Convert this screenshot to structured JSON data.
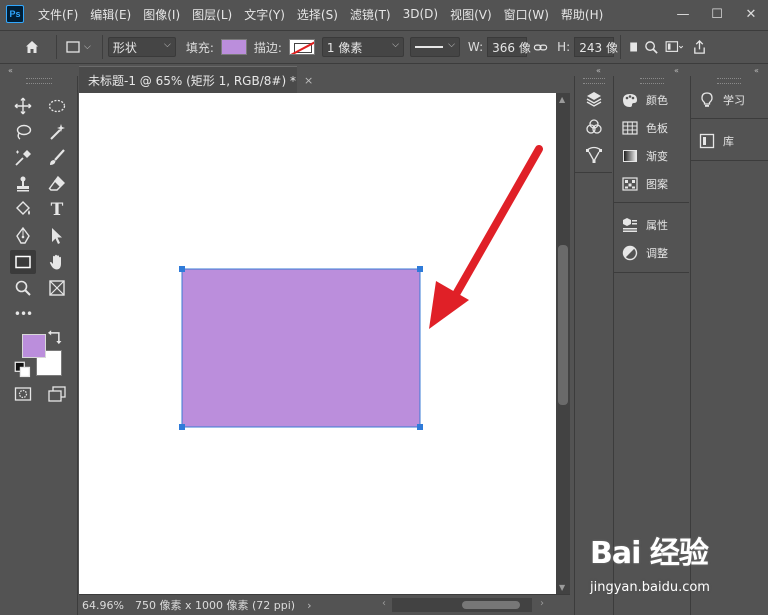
{
  "app": {
    "logo_text": "Ps",
    "menus": [
      "文件(F)",
      "编辑(E)",
      "图像(I)",
      "图层(L)",
      "文字(Y)",
      "选择(S)",
      "滤镜(T)",
      "3D(D)",
      "视图(V)",
      "窗口(W)",
      "帮助(H)"
    ],
    "window_buttons": {
      "minimize": "—",
      "restore": "☐",
      "close": "✕"
    }
  },
  "options_bar": {
    "home_icon": "home-icon",
    "tool_mode": "形状",
    "fill_label": "填充:",
    "fill_color": "#BB8EDC",
    "stroke_label": "描边:",
    "stroke_width": "1 像素",
    "width_label": "W:",
    "width_value": "366 像",
    "height_label": "H:",
    "height_value": "243 像"
  },
  "document": {
    "tab_title": "未标题-1 @ 65% (矩形 1, RGB/8#) *",
    "close_glyph": "×",
    "zoom": "64.96%",
    "info": "750 像素 x 1000 像素 (72 ppi)",
    "status_arrow": "›",
    "rect_color": "#BB8EDC",
    "rect_stroke": "#3A7BD5",
    "arrow_color": "#E02027"
  },
  "toolbar": {
    "foreground_color": "#BB8EDC",
    "background_color": "#FFFFFF",
    "more_glyph": "•••"
  },
  "panels": {
    "group1": [
      {
        "icon": "color-icon",
        "label": "颜色"
      },
      {
        "icon": "swatches-icon",
        "label": "色板"
      },
      {
        "icon": "gradient-icon",
        "label": "渐变"
      },
      {
        "icon": "patterns-icon",
        "label": "图案"
      }
    ],
    "group2": [
      {
        "icon": "properties-icon",
        "label": "属性"
      },
      {
        "icon": "adjustments-icon",
        "label": "调整"
      }
    ],
    "group3": [
      {
        "icon": "learn-icon",
        "label": "学习"
      },
      {
        "icon": "libraries-icon",
        "label": "库"
      }
    ],
    "collapse_glyph": "«"
  },
  "watermark": {
    "logo": "Bai 经验",
    "url": "jingyan.baidu.com"
  }
}
